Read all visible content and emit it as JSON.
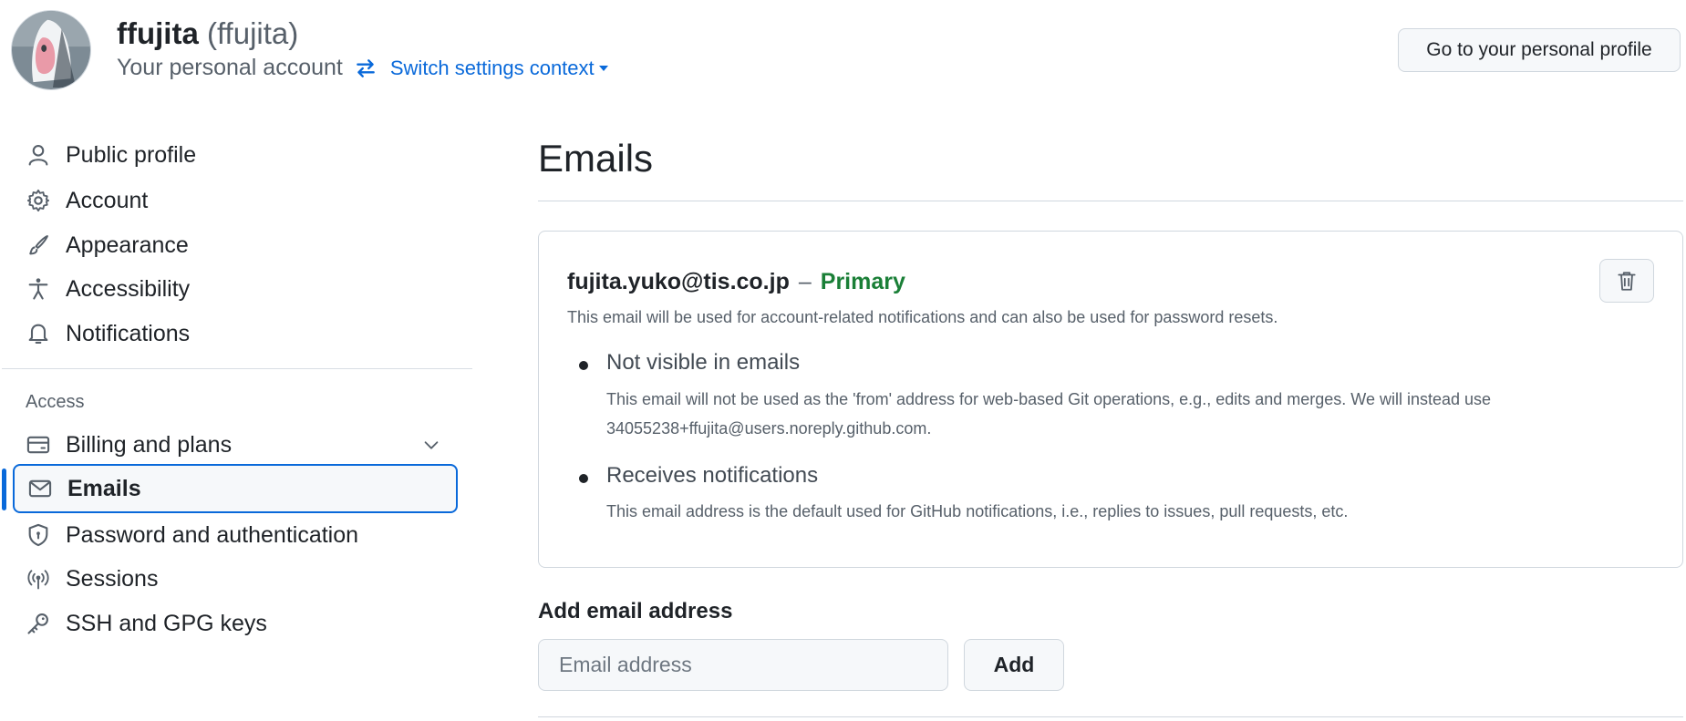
{
  "header": {
    "display_name": "ffujita",
    "login": "(ffujita)",
    "subtitle": "Your personal account",
    "switch_context": "Switch settings context",
    "profile_button": "Go to your personal profile"
  },
  "sidebar": {
    "items": [
      {
        "label": "Public profile",
        "icon": "person-icon"
      },
      {
        "label": "Account",
        "icon": "gear-icon"
      },
      {
        "label": "Appearance",
        "icon": "paintbrush-icon"
      },
      {
        "label": "Accessibility",
        "icon": "accessibility-icon"
      },
      {
        "label": "Notifications",
        "icon": "bell-icon"
      }
    ],
    "access_label": "Access",
    "access_items": [
      {
        "label": "Billing and plans",
        "icon": "credit-card-icon"
      },
      {
        "label": "Emails",
        "icon": "mail-icon"
      },
      {
        "label": "Password and authentication",
        "icon": "shield-lock-icon"
      },
      {
        "label": "Sessions",
        "icon": "broadcast-icon"
      },
      {
        "label": "SSH and GPG keys",
        "icon": "key-icon"
      }
    ]
  },
  "main": {
    "title": "Emails",
    "email": {
      "address": "fujita.yuko@tis.co.jp",
      "dash": "–",
      "badge": "Primary",
      "description": "This email will be used for account-related notifications and can also be used for password resets.",
      "bullets": [
        {
          "title": "Not visible in emails",
          "description": "This email will not be used as the 'from' address for web-based Git operations, e.g., edits and merges. We will instead use 34055238+ffujita@users.noreply.github.com."
        },
        {
          "title": "Receives notifications",
          "description": "This email address is the default used for GitHub notifications, i.e., replies to issues, pull requests, etc."
        }
      ]
    },
    "add_email": {
      "label": "Add email address",
      "placeholder": "Email address",
      "button": "Add"
    }
  },
  "colors": {
    "accent": "#0969da",
    "primary_badge": "#1a7f37",
    "border": "#d0d7de",
    "muted_text": "#57606a"
  }
}
